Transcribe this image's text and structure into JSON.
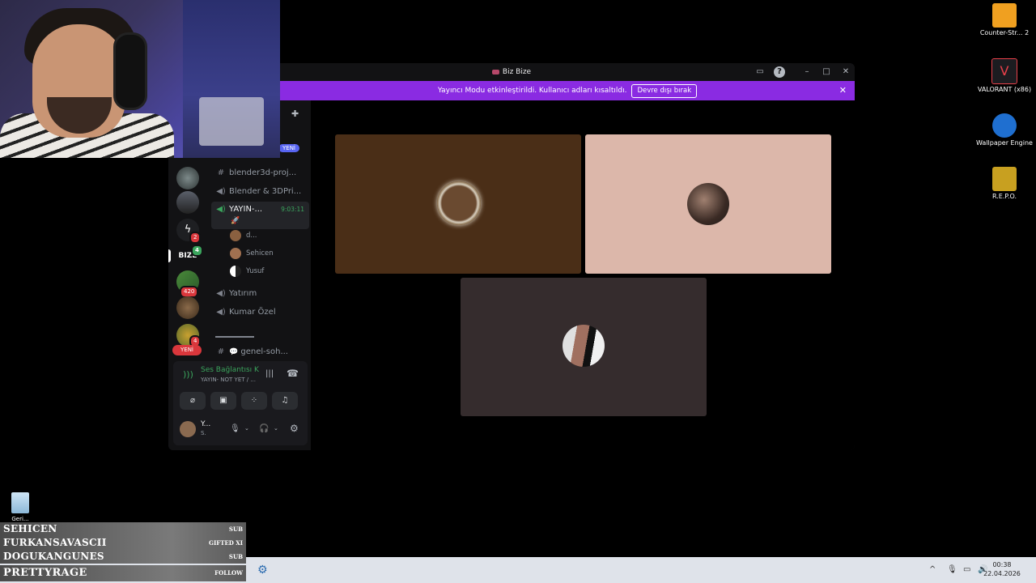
{
  "window": {
    "title": "Biz Bize",
    "banner_text": "Yayıncı Modu etkinleştirildi. Kullanıcı adları kısaltıldı.",
    "banner_button": "Devre dışı bırak"
  },
  "servers": {
    "badges": [
      "2",
      "420",
      "4"
    ],
    "active_server_label": "BIZE",
    "active_server_badge": "4",
    "new_pill": "YENİ",
    "top_new_pill": "YENİ"
  },
  "channels": {
    "items": [
      {
        "type": "text",
        "name": "blender3d-proj..."
      },
      {
        "type": "voice",
        "name": "Blender & 3DPri..."
      },
      {
        "type": "voice-active",
        "name": "YAYIN-...",
        "timer": "9:03:11"
      },
      {
        "type": "voice",
        "name": "Yatırım"
      },
      {
        "type": "voice",
        "name": "Kumar Özel"
      },
      {
        "type": "text",
        "name": "genel-soh..."
      }
    ],
    "voice_users": [
      "d...",
      "Sehicen",
      "Yusuf"
    ]
  },
  "voice_panel": {
    "status": "Ses Bağlantısı K",
    "channel": "YAYIN- NOT YET / ...",
    "user_name": "Y...",
    "user_status": "S."
  },
  "desktop_icons": [
    {
      "label": "Counter-Str... 2",
      "color": "#f0a020"
    },
    {
      "label": "VALORANT (x86)",
      "color": "#e8404a"
    },
    {
      "label": "Wallpaper Engine",
      "color": "#1f6fd0"
    },
    {
      "label": "R.E.P.O.",
      "color": "#c8a020"
    }
  ],
  "recycle_bin": "Geri...",
  "alerts": [
    {
      "name": "SEHICEN",
      "tag": "SUB"
    },
    {
      "name": "FURKANSAVASCII",
      "tag": "GIFTED XI"
    },
    {
      "name": "DOGUKANGUNES",
      "tag": "SUB"
    },
    {
      "name": "PRETTYRAGE",
      "tag": "FOLLOW"
    }
  ],
  "clock": {
    "time": "00:38",
    "date": "22.04.2026"
  },
  "colors": {
    "accent": "#8a2be2",
    "blurple": "#5865f2",
    "voice_green": "#3ba55d"
  }
}
